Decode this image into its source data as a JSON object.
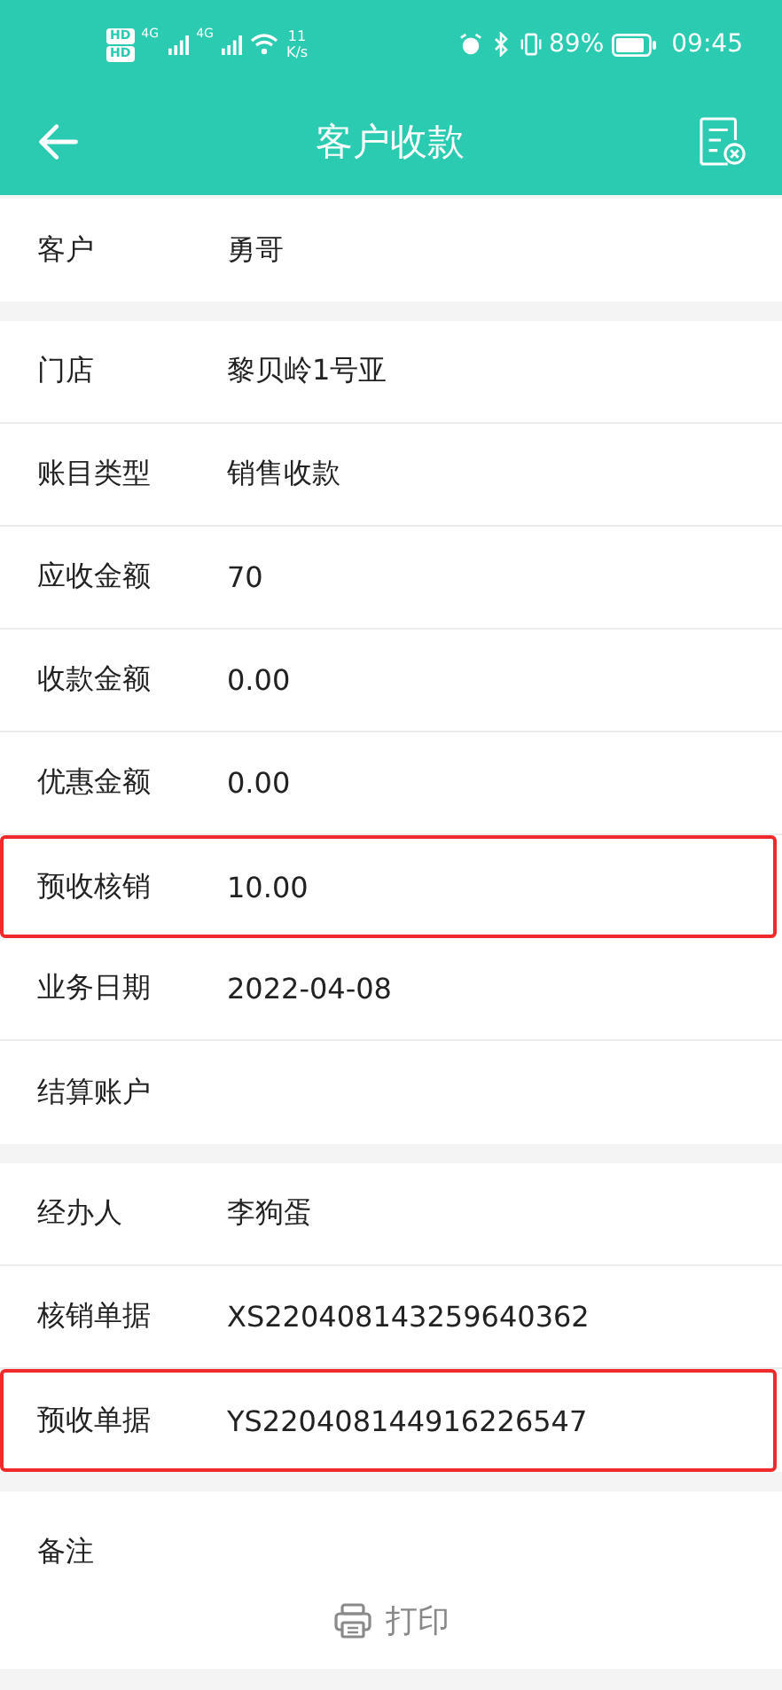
{
  "status_bar": {
    "sim_badges": [
      "HD",
      "HD"
    ],
    "networks": [
      "4G",
      "4G"
    ],
    "speed": [
      "11",
      "K/s"
    ],
    "battery": "89%",
    "time": "09:45"
  },
  "header": {
    "title": "客户收款"
  },
  "sections": [
    {
      "rows": [
        {
          "label": "客户",
          "value": "勇哥",
          "highlighted": false
        }
      ]
    },
    {
      "rows": [
        {
          "label": "门店",
          "value": "黎贝岭1号亚",
          "highlighted": false
        },
        {
          "label": "账目类型",
          "value": "销售收款",
          "highlighted": false
        },
        {
          "label": "应收金额",
          "value": "70",
          "highlighted": false
        },
        {
          "label": "收款金额",
          "value": "0.00",
          "highlighted": false
        },
        {
          "label": "优惠金额",
          "value": "0.00",
          "highlighted": false
        },
        {
          "label": "预收核销",
          "value": "10.00",
          "highlighted": true
        },
        {
          "label": "业务日期",
          "value": "2022-04-08",
          "highlighted": false
        },
        {
          "label": "结算账户",
          "highlighted": false
        }
      ]
    },
    {
      "rows": [
        {
          "label": "经办人",
          "value": "李狗蛋",
          "highlighted": false
        },
        {
          "label": "核销单据",
          "value": "XS220408143259640362",
          "highlighted": false
        },
        {
          "label": "预收单据",
          "value": "YS220408144916226547",
          "highlighted": true
        }
      ]
    }
  ],
  "remarks": {
    "label": "备注",
    "print_button": "打印"
  }
}
